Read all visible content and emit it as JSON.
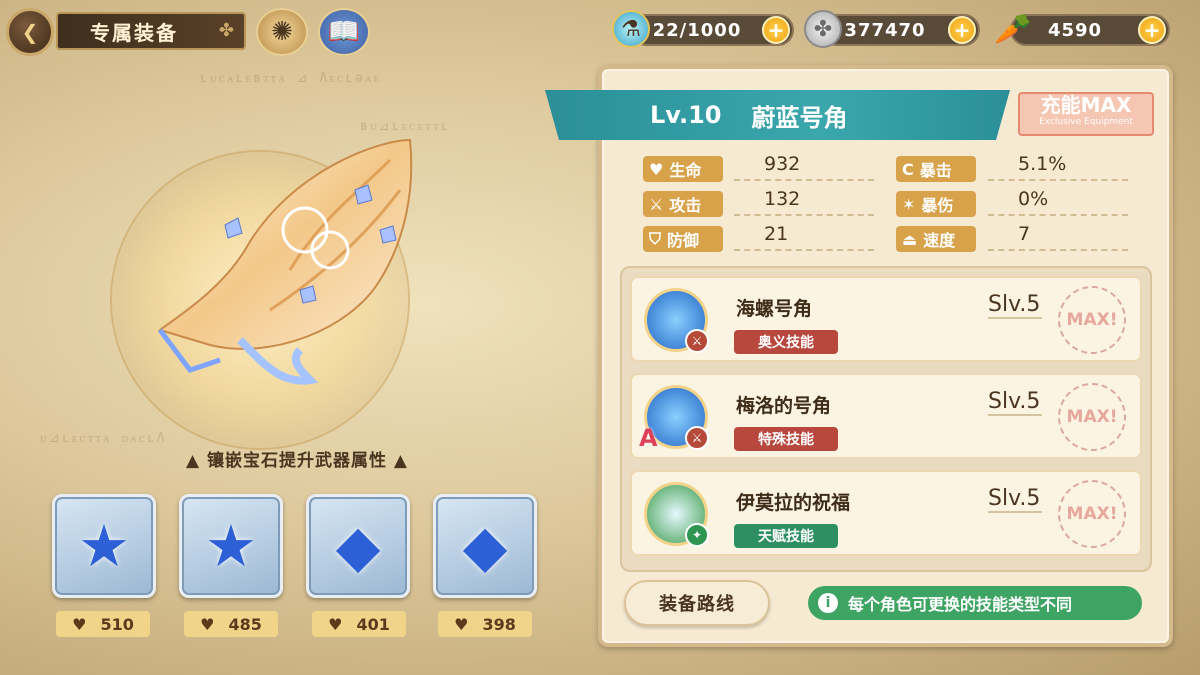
{
  "header": {
    "title": "专属装备",
    "resources": [
      {
        "icon": "potion-icon",
        "value": "22/1000"
      },
      {
        "icon": "clover-coin-icon",
        "value": "377470"
      },
      {
        "icon": "carrot-icon",
        "value": "4590"
      }
    ]
  },
  "equipment": {
    "level": "Lv.10",
    "name": "蔚蓝号角",
    "badge": "充能MAX",
    "badge_sub": "Exclusive Equipment",
    "stats": [
      {
        "label": "生命",
        "value": "932"
      },
      {
        "label": "攻击",
        "value": "132"
      },
      {
        "label": "防御",
        "value": "21"
      },
      {
        "label": "暴击",
        "value": "5.1%"
      },
      {
        "label": "暴伤",
        "value": "0%"
      },
      {
        "label": "速度",
        "value": "7"
      }
    ]
  },
  "gems": {
    "hint": "镶嵌宝石提升武器属性",
    "slots": [
      {
        "value": "510"
      },
      {
        "value": "485"
      },
      {
        "value": "401"
      },
      {
        "value": "398"
      }
    ]
  },
  "skills": [
    {
      "name": "海螺号角",
      "tag": "奥义技能",
      "level": "Slv.5",
      "max": "MAX!",
      "tag_color": "#b8473e"
    },
    {
      "name": "梅洛的号角",
      "tag": "特殊技能",
      "level": "Slv.5",
      "max": "MAX!",
      "tag_color": "#b8473e"
    },
    {
      "name": "伊莫拉的祝福",
      "tag": "天赋技能",
      "level": "Slv.5",
      "max": "MAX!",
      "tag_color": "#2e8f63"
    }
  ],
  "footer": {
    "route_button": "装备路线",
    "tip": "每个角色可更换的技能类型不同"
  }
}
